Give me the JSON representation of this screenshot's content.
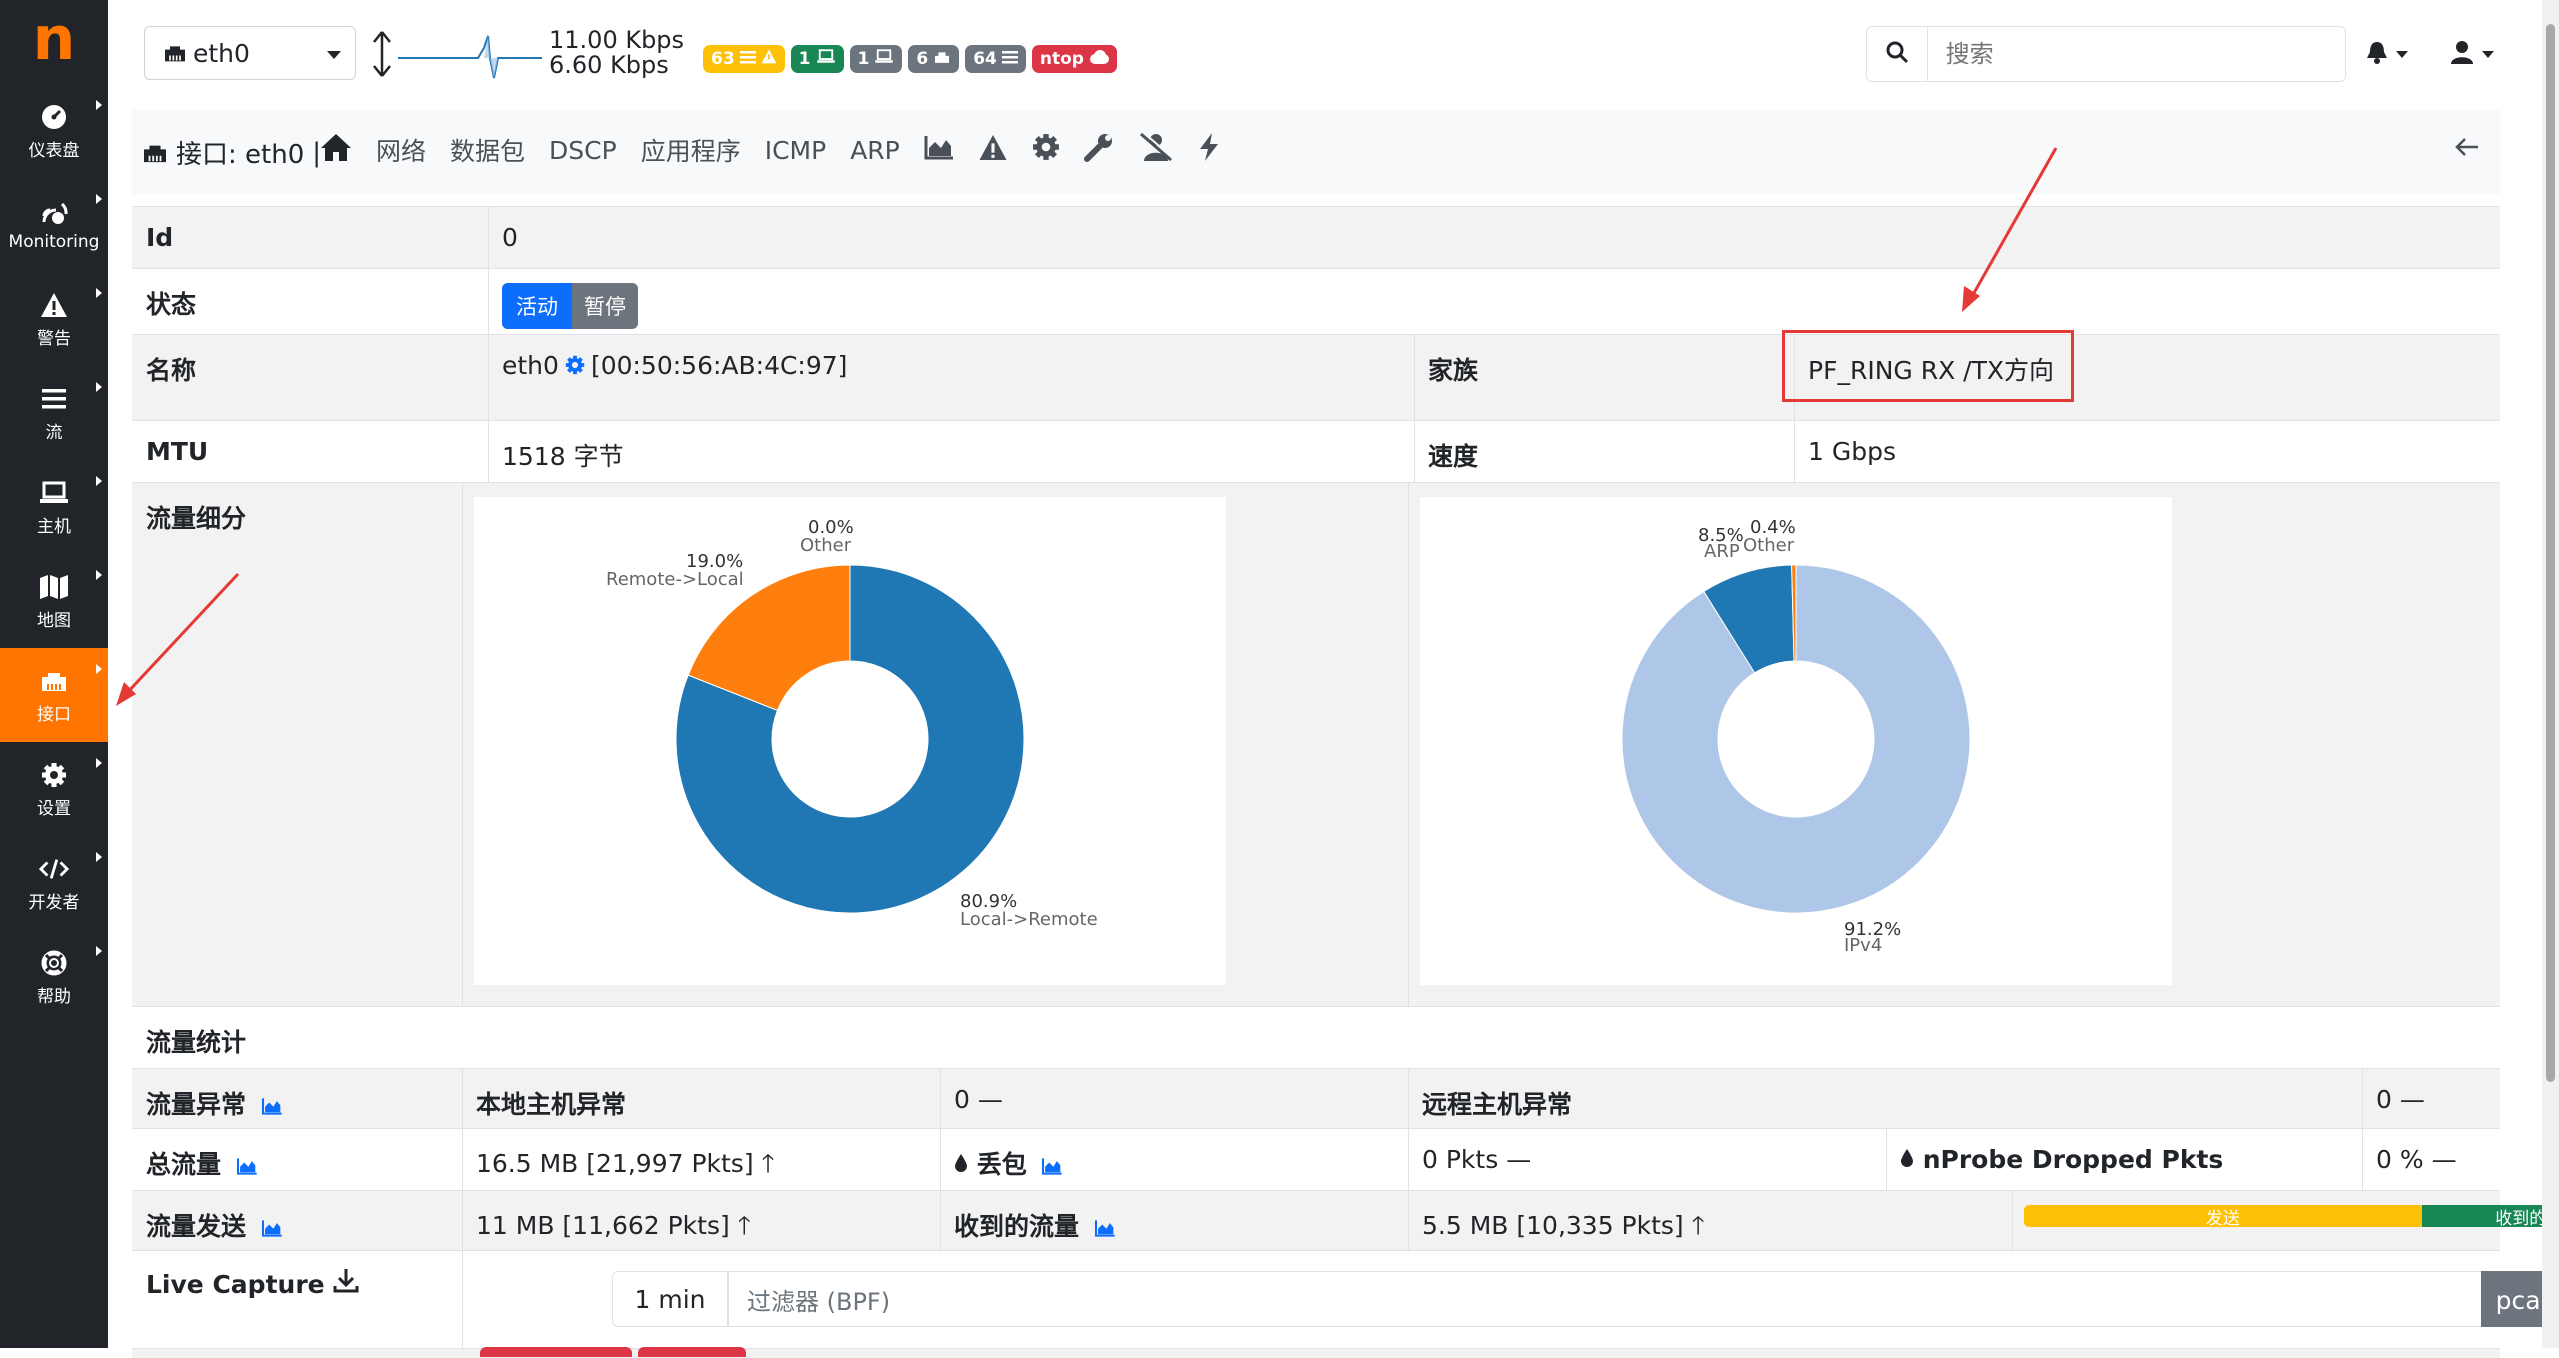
{
  "sidebar": {
    "logo": "n",
    "items": [
      {
        "label": "仪表盘",
        "icon": "gauge-icon"
      },
      {
        "label": "Monitoring",
        "icon": "monitoring-icon"
      },
      {
        "label": "警告",
        "icon": "warning-icon"
      },
      {
        "label": "流",
        "icon": "bars-icon"
      },
      {
        "label": "主机",
        "icon": "laptop-icon"
      },
      {
        "label": "地图",
        "icon": "map-icon"
      },
      {
        "label": "接口",
        "icon": "ethernet-icon",
        "active": true
      },
      {
        "label": "设置",
        "icon": "gear-icon"
      },
      {
        "label": "开发者",
        "icon": "code-icon"
      },
      {
        "label": "帮助",
        "icon": "lifebuoy-icon"
      }
    ]
  },
  "topbar": {
    "interface": "eth0",
    "rate_up": "11.00 Kbps",
    "rate_down": "6.60 Kbps",
    "badges": [
      {
        "text": "63",
        "icon": "alerts-list-icon",
        "color": "#ffc107",
        "text_color": "#fff"
      },
      {
        "text": "1",
        "icon": "laptop-icon",
        "color": "#198754"
      },
      {
        "text": "1",
        "icon": "laptop-icon",
        "color": "#6c757d"
      },
      {
        "text": "6",
        "icon": "devices-icon",
        "color": "#6c757d"
      },
      {
        "text": "64",
        "icon": "flows-icon",
        "color": "#6c757d"
      },
      {
        "text": "ntop",
        "icon": "cloud-icon",
        "color": "#dc3545"
      }
    ],
    "search_placeholder": "搜索"
  },
  "nav": {
    "title": "接口: eth0",
    "separator": "|",
    "links": [
      "网络",
      "数据包",
      "DSCP",
      "应用程序",
      "ICMP",
      "ARP"
    ]
  },
  "table": {
    "id_label": "Id",
    "id_value": "0",
    "state_label": "状态",
    "state_active": "活动",
    "state_pause": "暂停",
    "name_label": "名称",
    "name_value": "eth0",
    "mac": "[00:50:56:AB:4C:97]",
    "family_label": "家族",
    "family_value": "PF_RING RX /TX方向",
    "mtu_label": "MTU",
    "mtu_value": "1518 字节",
    "speed_label": "速度",
    "speed_value": "1 Gbps",
    "breakdown_label": "流量细分",
    "stats_label": "流量统计",
    "anomaly_label": "流量异常",
    "local_anomaly_label": "本地主机异常",
    "local_anomaly_value": "0",
    "remote_anomaly_label": "远程主机异常",
    "remote_anomaly_value": "0",
    "total_label": "总流量",
    "total_value": "16.5 MB [21,997 Pkts]",
    "drops_label": "丢包",
    "drops_value": "0 Pkts",
    "nprobe_label": "nProbe Dropped Pkts",
    "nprobe_value": "0 %",
    "sent_label": "流量发送",
    "sent_value": "11 MB [11,662 Pkts]",
    "recv_label": "收到的流量",
    "recv_value": "5.5 MB [10,335 Pkts]",
    "bar_sent": "发送",
    "bar_recv": "收到的",
    "bar_sent_fraction": 0.667,
    "capture_label": "Live Capture",
    "capture_duration": "1 min",
    "capture_filter_placeholder": "过滤器 (BPF)",
    "capture_button": "pcap下载"
  },
  "chart_data": [
    {
      "type": "pie",
      "labels": [
        "Local->Remote",
        "Remote->Local",
        "Other"
      ],
      "values": [
        80.9,
        19.0,
        0.0
      ],
      "value_labels": [
        "80.9%",
        "19.0%",
        "0.0%"
      ],
      "colors": [
        "#1f77b4",
        "#ff7f0e",
        "#2ca02c"
      ]
    },
    {
      "type": "pie",
      "labels": [
        "IPv4",
        "ARP",
        "Other"
      ],
      "values": [
        91.2,
        8.5,
        0.4
      ],
      "value_labels": [
        "91.2%",
        "8.5%",
        "0.4%"
      ],
      "colors": [
        "#aec7e8",
        "#1f77b4",
        "#ff7f0e"
      ]
    }
  ]
}
